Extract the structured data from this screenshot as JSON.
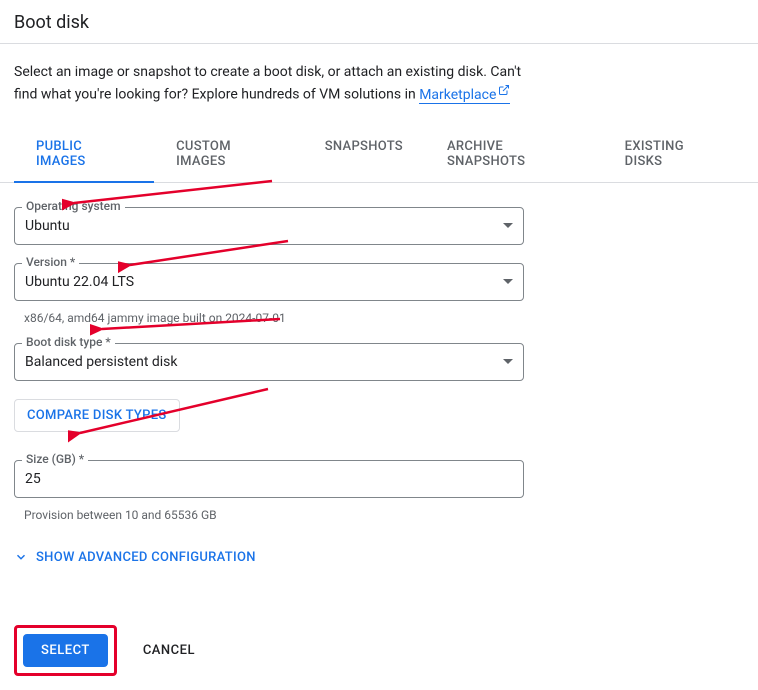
{
  "header": {
    "title": "Boot disk"
  },
  "intro": {
    "text_before": "Select an image or snapshot to create a boot disk, or attach an existing disk. Can't find what you're looking for? Explore hundreds of VM solutions in",
    "link_label": "Marketplace"
  },
  "tabs": {
    "items": [
      {
        "label": "PUBLIC IMAGES",
        "active": true
      },
      {
        "label": "CUSTOM IMAGES",
        "active": false
      },
      {
        "label": "SNAPSHOTS",
        "active": false
      },
      {
        "label": "ARCHIVE SNAPSHOTS",
        "active": false
      },
      {
        "label": "EXISTING DISKS",
        "active": false
      }
    ]
  },
  "form": {
    "os": {
      "label": "Operating system",
      "value": "Ubuntu"
    },
    "version": {
      "label": "Version *",
      "value": "Ubuntu 22.04 LTS",
      "helper": "x86/64, amd64 jammy image built on 2024-07-01"
    },
    "disk_type": {
      "label": "Boot disk type *",
      "value": "Balanced persistent disk"
    },
    "compare_label": "COMPARE DISK TYPES",
    "size": {
      "label": "Size (GB) *",
      "value": "25",
      "helper": "Provision between 10 and 65536 GB"
    },
    "advanced_label": "SHOW ADVANCED CONFIGURATION"
  },
  "footer": {
    "select_label": "SELECT",
    "cancel_label": "CANCEL"
  }
}
